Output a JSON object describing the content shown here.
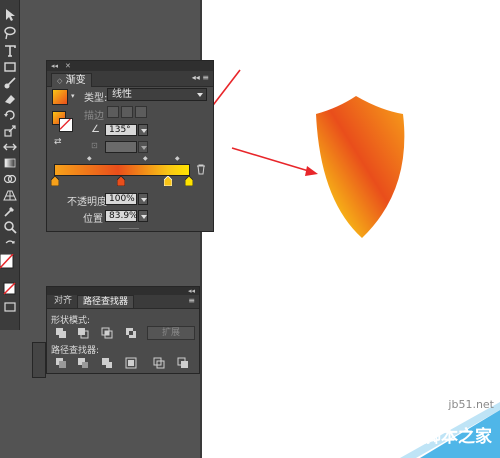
{
  "gradient_panel": {
    "tab_label": "渐变",
    "type_label": "类型:",
    "type_value": "线性",
    "stroke_label": "描边",
    "angle_value": "135°",
    "opacity_label": "不透明度",
    "opacity_value": "100%",
    "location_label": "位置",
    "location_value": "83.9%",
    "gradient_stops": [
      {
        "position": 0,
        "color": "#F7A11A"
      },
      {
        "position": 0.47,
        "color": "#E94E1B"
      },
      {
        "position": 0.84,
        "color": "#F9C416"
      },
      {
        "position": 1,
        "color": "#FFE300"
      }
    ]
  },
  "pathfinder_panel": {
    "tab_align": "对齐",
    "tab_pathfinder": "路径查找器",
    "shape_modes_label": "形状模式:",
    "expand_label": "扩展",
    "pathfinders_label": "路径查找器:"
  },
  "watermark": {
    "site": "jb51.net",
    "name": "脚本之家"
  },
  "colors": {
    "annotation_arrow": "#E8262A",
    "shield_light": "#FFE000",
    "shield_mid": "#F49A14",
    "shield_dark": "#E84E1B"
  }
}
